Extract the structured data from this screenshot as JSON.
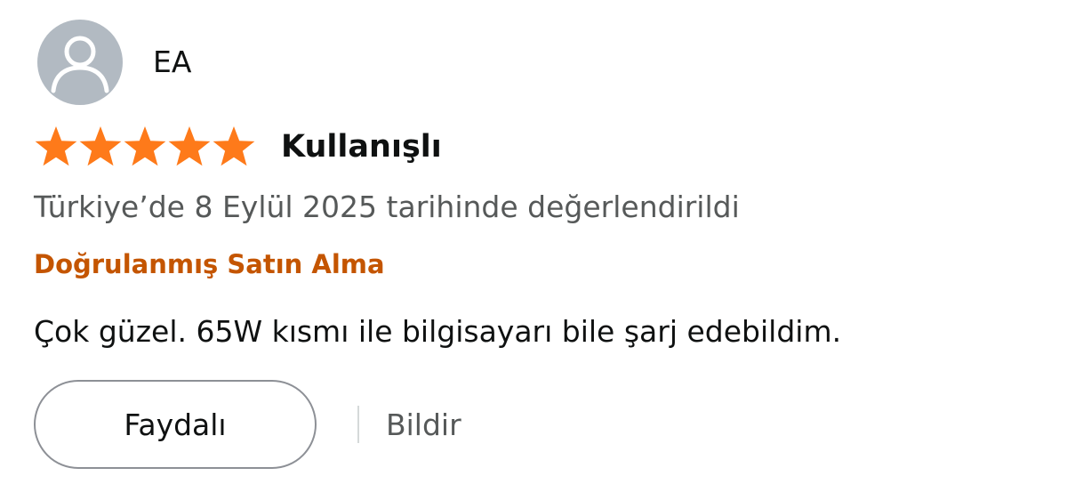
{
  "reviewer": {
    "name": "EA",
    "avatar_icon": "user-silhouette-icon",
    "avatar_color": "#b2bac2"
  },
  "review": {
    "rating": 5,
    "rating_max": 5,
    "star_icon": "star-icon",
    "star_color": "#fe7a1a",
    "title": "Kullanışlı",
    "date_text": "Türkiye’de 8 Eylül 2025 tarihinde değerlendirildi",
    "verified_label": "Doğrulanmış Satın Alma",
    "verified_color": "#c45500",
    "body": "Çok güzel. 65W kısmı ile bilgisayarı bile şarj edebildim."
  },
  "actions": {
    "helpful_label": "Faydalı",
    "report_label": "Bildir"
  }
}
